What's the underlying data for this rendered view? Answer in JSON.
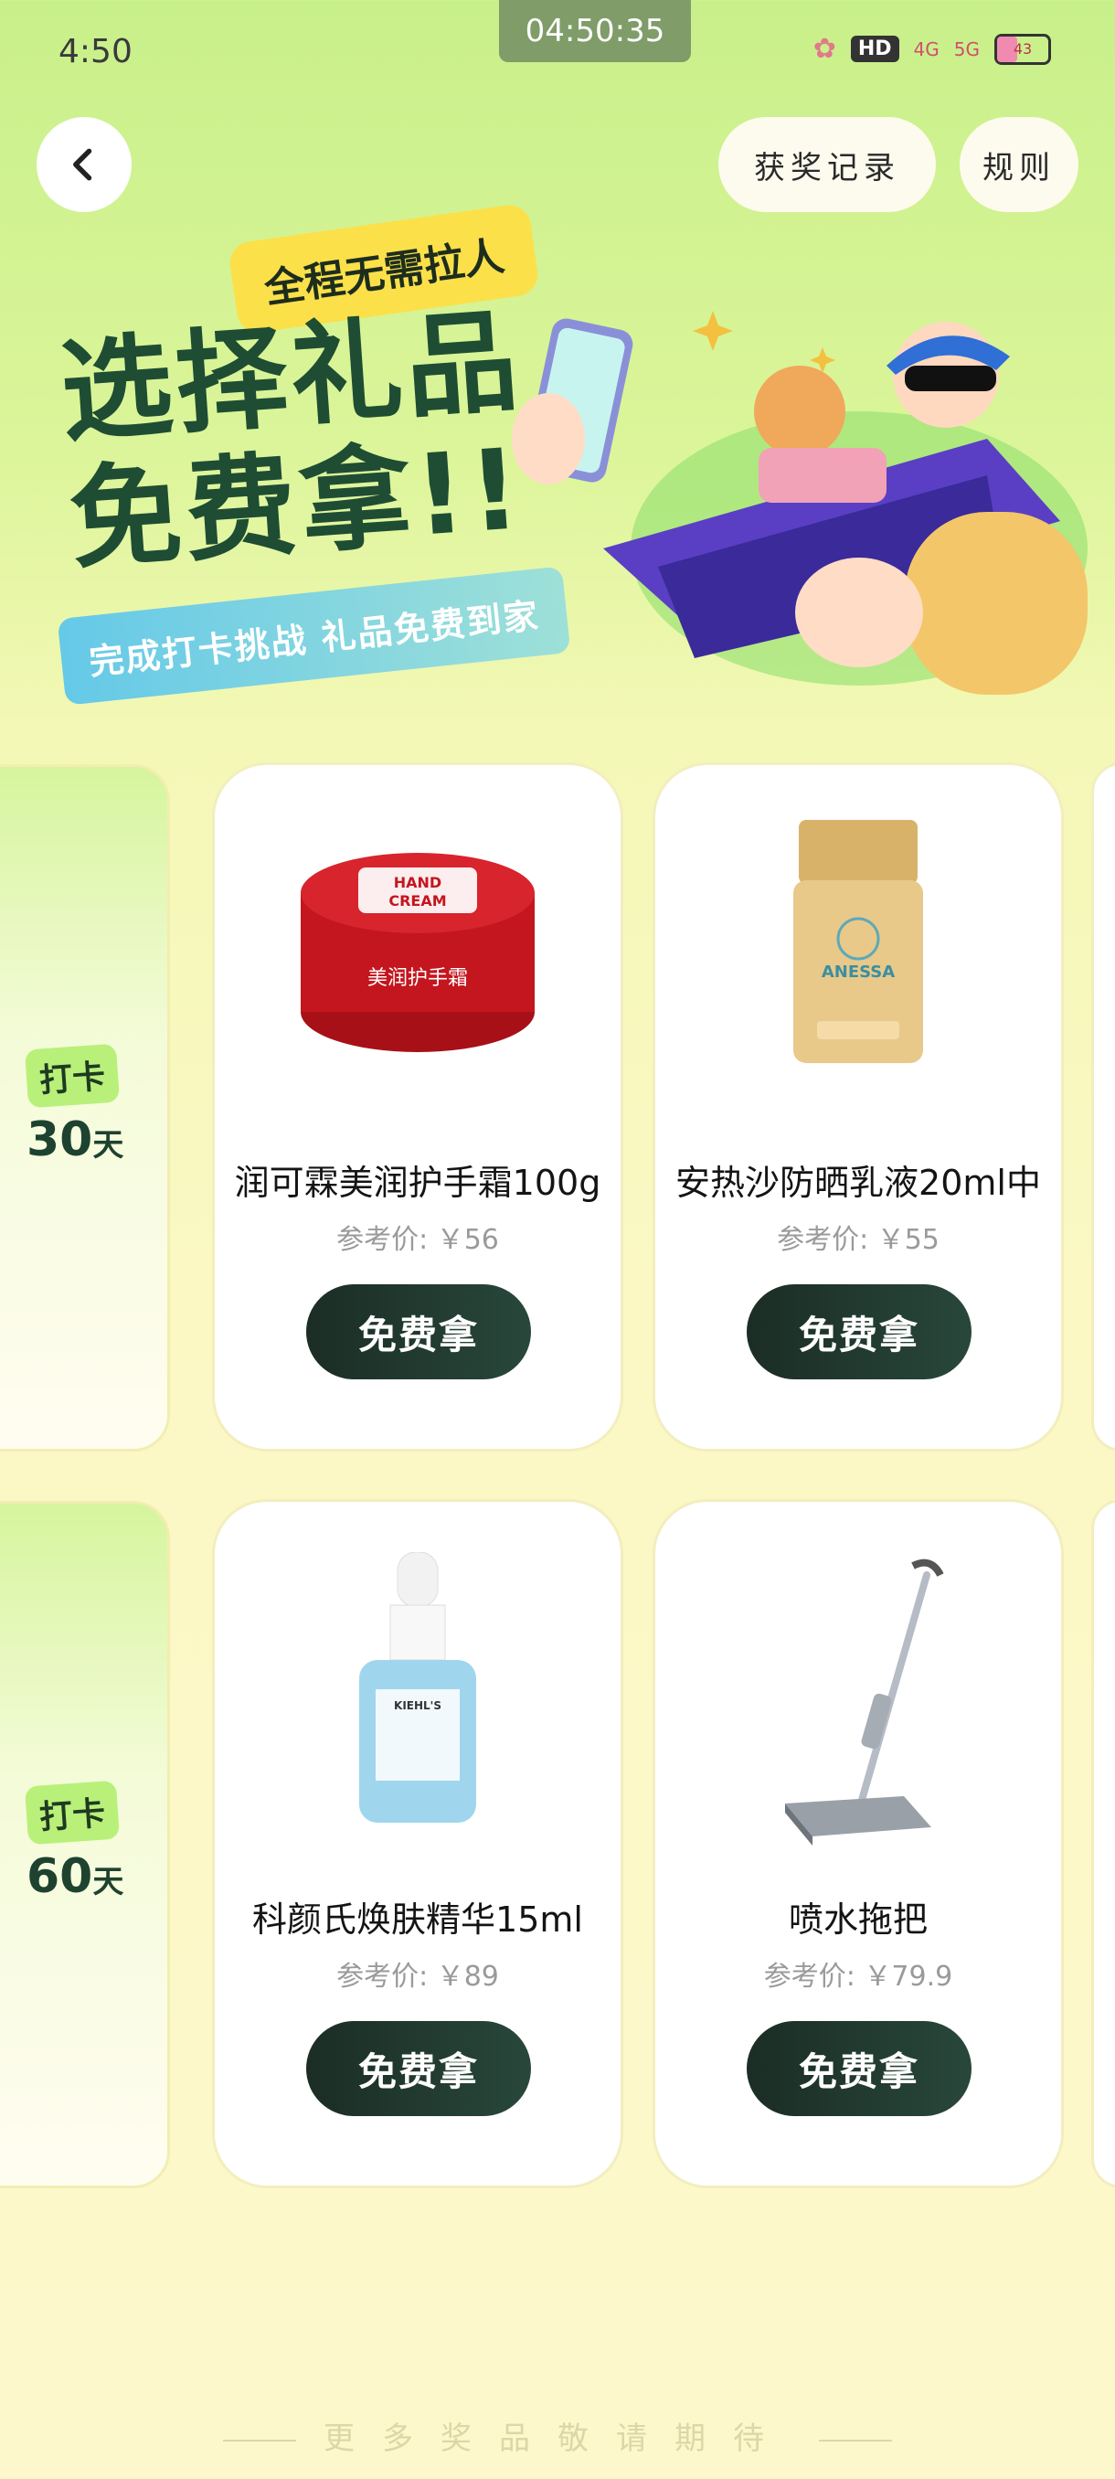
{
  "status_bar": {
    "time": "4:50",
    "timer": "04:50:35",
    "hd": "HD",
    "signal_1": "4G",
    "signal_2": "5G",
    "battery": "43"
  },
  "header": {
    "records_label": "获奖记录",
    "rules_label": "规则"
  },
  "banner": {
    "tag": "全程无需拉人",
    "headline_1": "选择礼品",
    "headline_2": "免费拿!!",
    "subtitle": "完成打卡挑战 礼品免费到家"
  },
  "sections": [
    {
      "badge": "打卡",
      "days": "30",
      "unit": "天",
      "products": [
        {
          "name": "润可霖美润护手霜100g",
          "price": "参考价: ￥56",
          "button": "免费拿",
          "image": "hand-cream-jar"
        },
        {
          "name": "安热沙防晒乳液20ml中",
          "price": "参考价: ￥55",
          "button": "免费拿",
          "image": "sunscreen-bottle"
        }
      ]
    },
    {
      "badge": "打卡",
      "days": "60",
      "unit": "天",
      "products": [
        {
          "name": "科颜氏焕肤精华15ml",
          "price": "参考价: ￥89",
          "button": "免费拿",
          "image": "serum-dropper-bottle"
        },
        {
          "name": "喷水拖把",
          "price": "参考价: ￥79.9",
          "button": "免费拿",
          "image": "spray-mop"
        }
      ]
    }
  ],
  "jar_label_1": "HAND",
  "jar_label_2": "CREAM",
  "jar_label_cn": "美润护手霜",
  "bottle_label": "ANESSA",
  "serum_label": "KIEHL'S",
  "footer": "更多奖品敬请期待"
}
